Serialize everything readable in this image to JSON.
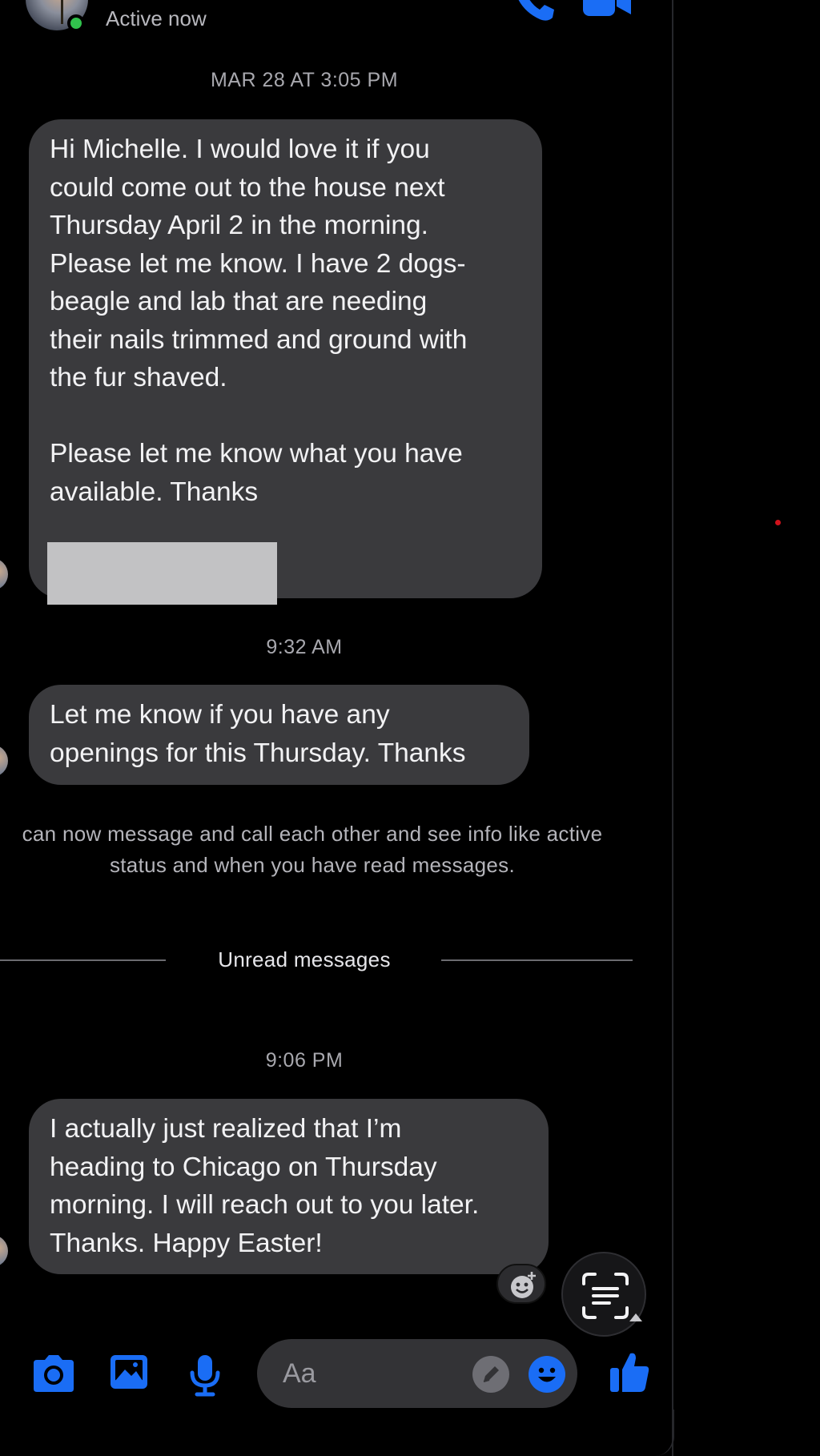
{
  "header": {
    "status": "Active now"
  },
  "messages": [
    {
      "timestamp": "MAR 28 AT 3:05 PM",
      "text": "Hi Michelle. I would love it if you\ncould come out to the house next\nThursday April 2 in the morning.\nPlease let me know. I have 2 dogs-\nbeagle and lab that are needing\ntheir nails trimmed and ground with\nthe fur shaved.\n\nPlease let me know what you have\navailable. Thanks"
    },
    {
      "timestamp": "9:32 AM",
      "text": "Let me know if you have any\nopenings for this Thursday. Thanks"
    },
    {
      "timestamp": "9:06 PM",
      "text": "I actually just realized that I’m\nheading to Chicago on Thursday\nmorning. I will reach out to you later.\nThanks. Happy Easter!"
    }
  ],
  "notice": {
    "text": "can now message and call each other and see info like active\nstatus and when you have read messages."
  },
  "divider": {
    "label": "Unread messages"
  },
  "composer": {
    "placeholder": "Aa"
  },
  "icons": [
    "phone-icon",
    "video-call-icon",
    "camera-icon",
    "gallery-icon",
    "microphone-icon",
    "edit-icon",
    "emoji-icon",
    "like-icon",
    "add-reaction-icon",
    "scan-text-icon"
  ],
  "colors": {
    "accent": "#1a6df5",
    "bubble": "#3a3a3d",
    "active": "#31c24d"
  }
}
